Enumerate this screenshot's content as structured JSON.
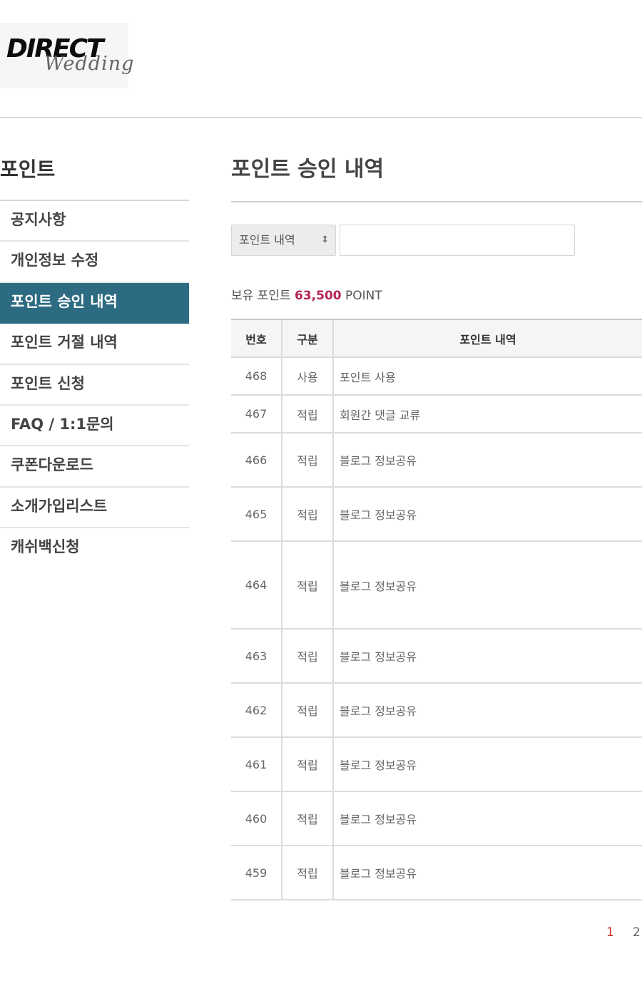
{
  "logo": {
    "main": "DIRECT",
    "script": "Wedding"
  },
  "sidebar": {
    "title": "포인트",
    "items": [
      {
        "label": "공지사항"
      },
      {
        "label": "개인정보 수정"
      },
      {
        "label": "포인트 승인 내역"
      },
      {
        "label": "포인트 거절 내역"
      },
      {
        "label": "포인트 신청"
      },
      {
        "label": "FAQ / 1:1문의"
      },
      {
        "label": "쿠폰다운로드"
      },
      {
        "label": "소개가입리스트"
      },
      {
        "label": "캐쉬백신청"
      }
    ],
    "active_index": 2
  },
  "main": {
    "title": "포인트 승인 내역",
    "search": {
      "select_value": "포인트 내역",
      "input_value": "",
      "input_placeholder": ""
    },
    "points": {
      "label": "보유 포인트",
      "value": "63,500",
      "unit": "POINT"
    },
    "table": {
      "headers": [
        "번호",
        "구분",
        "포인트 내역"
      ],
      "rows": [
        {
          "num": "468",
          "type": "사용",
          "desc": "포인트 사용"
        },
        {
          "num": "467",
          "type": "적립",
          "desc": "회원간 댓글 교류"
        },
        {
          "num": "466",
          "type": "적립",
          "desc": "블로그 정보공유"
        },
        {
          "num": "465",
          "type": "적립",
          "desc": "블로그 정보공유"
        },
        {
          "num": "464",
          "type": "적립",
          "desc": "블로그 정보공유"
        },
        {
          "num": "463",
          "type": "적립",
          "desc": "블로그 정보공유"
        },
        {
          "num": "462",
          "type": "적립",
          "desc": "블로그 정보공유"
        },
        {
          "num": "461",
          "type": "적립",
          "desc": "블로그 정보공유"
        },
        {
          "num": "460",
          "type": "적립",
          "desc": "블로그 정보공유"
        },
        {
          "num": "459",
          "type": "적립",
          "desc": "블로그 정보공유"
        }
      ]
    },
    "pagination": {
      "pages": [
        "1",
        "2"
      ],
      "current": "1"
    }
  },
  "colors": {
    "accent": "#2d6b82",
    "points_highlight": "#b5245a",
    "current_page": "#c62828"
  }
}
